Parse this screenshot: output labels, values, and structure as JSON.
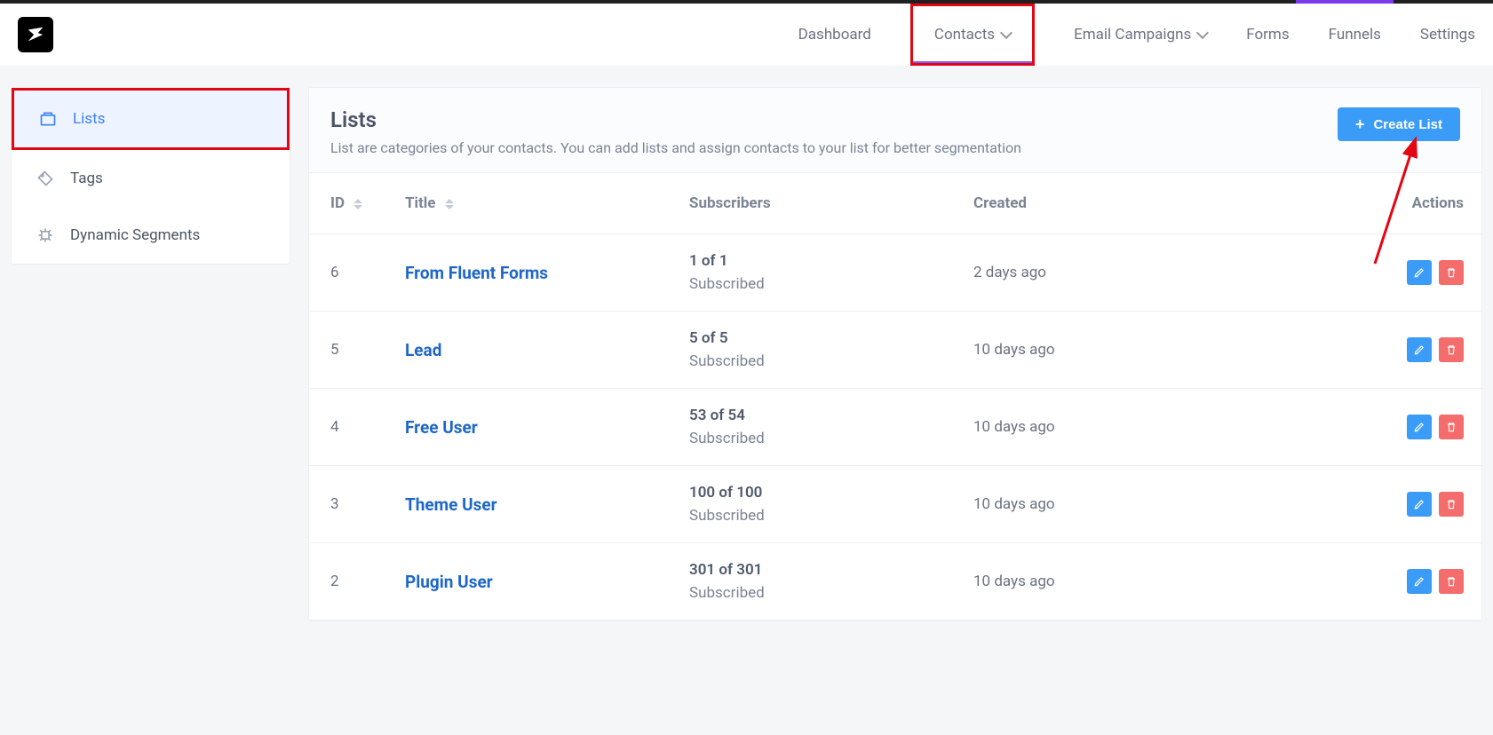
{
  "nav": {
    "dashboard": "Dashboard",
    "contacts": "Contacts",
    "email_campaigns": "Email Campaigns",
    "forms": "Forms",
    "funnels": "Funnels",
    "settings": "Settings"
  },
  "sidebar": {
    "lists": "Lists",
    "tags": "Tags",
    "dynamic_segments": "Dynamic Segments"
  },
  "page": {
    "title": "Lists",
    "subtitle": "List are categories of your contacts. You can add lists and assign contacts to your list for better segmentation",
    "create_button": "Create List"
  },
  "columns": {
    "id": "ID",
    "title": "Title",
    "subscribers": "Subscribers",
    "created": "Created",
    "actions": "Actions"
  },
  "rows": [
    {
      "id": "6",
      "title": "From Fluent Forms",
      "sub_count": "1 of 1",
      "sub_status": "Subscribed",
      "created": "2 days ago"
    },
    {
      "id": "5",
      "title": "Lead",
      "sub_count": "5 of 5",
      "sub_status": "Subscribed",
      "created": "10 days ago"
    },
    {
      "id": "4",
      "title": "Free User",
      "sub_count": "53 of 54",
      "sub_status": "Subscribed",
      "created": "10 days ago"
    },
    {
      "id": "3",
      "title": "Theme User",
      "sub_count": "100 of 100",
      "sub_status": "Subscribed",
      "created": "10 days ago"
    },
    {
      "id": "2",
      "title": "Plugin User",
      "sub_count": "301 of 301",
      "sub_status": "Subscribed",
      "created": "10 days ago"
    }
  ]
}
